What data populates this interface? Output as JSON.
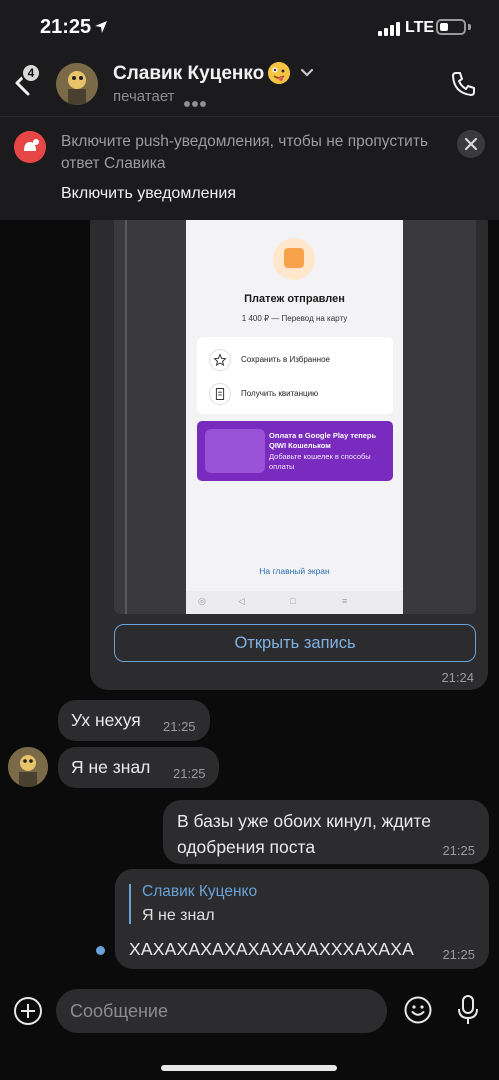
{
  "status_bar": {
    "time": "21:25",
    "network": "LTE"
  },
  "header": {
    "unread_count": "4",
    "name": "Славик Куценко",
    "status": "печатает"
  },
  "push_banner": {
    "text": "Включите push-уведомления, чтобы не пропустить ответ Славика",
    "action": "Включить уведомления"
  },
  "post": {
    "screenshot": {
      "title": "Платеж отправлен",
      "subtitle": "1 400 ₽ — Перевод на карту",
      "actions": [
        "Сохранить в Избранное",
        "Получить квитанцию"
      ],
      "promo_title": "Оплата в Google Play теперь QIWI Кошельком",
      "promo_text": "Добавьте кошелек в способы оплаты",
      "home_link": "На главный экран"
    },
    "open_button": "Открыть запись",
    "time": "21:24"
  },
  "messages": [
    {
      "text": "Ух нехуя",
      "time": "21:25"
    },
    {
      "text": "Я не знал",
      "time": "21:25"
    },
    {
      "text": "В базы уже обоих кинул, ждите одобрения поста",
      "time": "21:25"
    },
    {
      "reply_name": "Славик Куценко",
      "reply_text": "Я не знал",
      "text": "ХАХАХАХАХАХАХАХАХХХАХАХА",
      "time": "21:25"
    }
  ],
  "composer": {
    "placeholder": "Сообщение"
  },
  "colors": {
    "background": "#0b0b0b",
    "bubble": "#2c2c2e",
    "accent": "#6aa2d8",
    "banner_icon": "#e64646"
  }
}
